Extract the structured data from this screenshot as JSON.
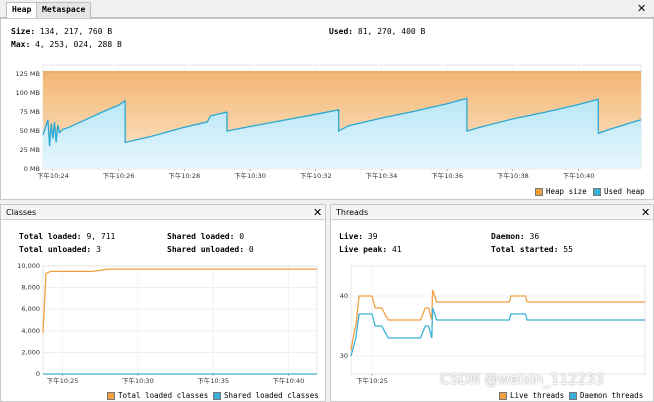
{
  "tabs": [
    {
      "label": "Heap",
      "active": true
    },
    {
      "label": "Metaspace",
      "active": false
    }
  ],
  "heap": {
    "size_label": "Size:",
    "size_value": "134, 217, 760 B",
    "used_label": "Used:",
    "used_value": "81, 270, 400 B",
    "max_label": "Max:",
    "max_value": "4, 253, 024, 288 B",
    "legend": [
      {
        "label": "Heap size",
        "color": "#f0a040"
      },
      {
        "label": "Used heap",
        "color": "#3ab0d8"
      }
    ]
  },
  "classes": {
    "title": "Classes",
    "total_loaded_label": "Total loaded:",
    "total_loaded_value": "9, 711",
    "shared_loaded_label": "Shared loaded:",
    "shared_loaded_value": "0",
    "total_unloaded_label": "Total unloaded:",
    "total_unloaded_value": "3",
    "shared_unloaded_label": "Shared unloaded:",
    "shared_unloaded_value": "0",
    "legend": [
      {
        "label": "Total loaded classes",
        "color": "#f0a040"
      },
      {
        "label": "Shared loaded classes",
        "color": "#3ab0d8"
      }
    ]
  },
  "threads": {
    "title": "Threads",
    "live_label": "Live:",
    "live_value": "39",
    "daemon_label": "Daemon:",
    "daemon_value": "36",
    "live_peak_label": "Live peak:",
    "live_peak_value": "41",
    "total_started_label": "Total started:",
    "total_started_value": "55",
    "legend": [
      {
        "label": "Live threads",
        "color": "#f0a040"
      },
      {
        "label": "Daemon threads",
        "color": "#3ab0d8"
      }
    ]
  },
  "watermark": "CSDN @weixin_112233",
  "chart_data": [
    {
      "type": "area",
      "name": "heap",
      "yticks": [
        "0 MB",
        "25 MB",
        "50 MB",
        "75 MB",
        "100 MB",
        "125 MB"
      ],
      "ylim": [
        0,
        137
      ],
      "xticks": [
        "下午10:24",
        "下午10:26",
        "下午10:28",
        "下午10:30",
        "下午10:32",
        "下午10:34",
        "下午10:36",
        "下午10:38",
        "下午10:40"
      ],
      "xlim": [
        23.7,
        41.9
      ],
      "series": [
        {
          "name": "Heap size",
          "values_x": [
            23.7,
            41.9
          ],
          "values_y": [
            128,
            128
          ]
        },
        {
          "name": "Used heap",
          "values_x": [
            23.7,
            23.85,
            23.9,
            23.95,
            24.0,
            24.05,
            24.1,
            24.15,
            24.2,
            24.3,
            24.5,
            25.0,
            25.5,
            26.0,
            26.2,
            26.201,
            27.0,
            28.0,
            28.7,
            28.8,
            29.3,
            29.301,
            30.0,
            31.0,
            32.0,
            32.7,
            32.701,
            33.0,
            34.0,
            35.0,
            36.0,
            36.6,
            36.601,
            37.0,
            38.0,
            39.0,
            40.0,
            40.6,
            40.601,
            41.0,
            41.9
          ],
          "values_y": [
            45,
            65,
            30,
            60,
            40,
            62,
            35,
            58,
            48,
            52,
            55,
            65,
            75,
            84,
            90,
            35,
            43,
            55,
            62,
            70,
            75,
            50,
            56,
            64,
            72,
            78,
            50,
            57,
            67,
            76,
            86,
            93,
            50,
            55,
            66,
            75,
            85,
            92,
            47,
            53,
            65
          ]
        }
      ]
    },
    {
      "type": "line",
      "name": "classes",
      "yticks": [
        "0",
        "2,000",
        "4,000",
        "6,000",
        "8,000",
        "10,000"
      ],
      "ylim": [
        0,
        10000
      ],
      "xticks": [
        "下午10:25",
        "下午10:30",
        "下午10:35",
        "下午10:40"
      ],
      "xlim": [
        23.7,
        41.9
      ],
      "series": [
        {
          "name": "Total loaded classes",
          "values_x": [
            23.7,
            23.9,
            24.2,
            27.0,
            28.0,
            41.9
          ],
          "values_y": [
            3800,
            9300,
            9500,
            9500,
            9711,
            9711
          ]
        },
        {
          "name": "Shared loaded classes",
          "values_x": [
            23.7,
            41.9
          ],
          "values_y": [
            0,
            0
          ]
        }
      ]
    },
    {
      "type": "line",
      "name": "threads",
      "yticks": [
        "30",
        "40"
      ],
      "ylim": [
        27,
        45
      ],
      "xticks": [
        "下午10:25"
      ],
      "xlim": [
        23.7,
        41.9
      ],
      "series": [
        {
          "name": "Live threads",
          "values_x": [
            23.7,
            23.9,
            24.0,
            24.2,
            25.0,
            25.2,
            25.6,
            26.0,
            28.0,
            28.3,
            28.5,
            28.7,
            28.75,
            29.0,
            33.5,
            33.6,
            34.5,
            34.6,
            41.9
          ],
          "values_y": [
            31,
            34,
            35,
            40,
            40,
            38,
            38,
            36,
            36,
            38,
            38,
            36,
            41,
            39,
            39,
            40,
            40,
            39,
            39
          ]
        },
        {
          "name": "Daemon threads",
          "values_x": [
            23.7,
            23.9,
            24.0,
            24.2,
            25.0,
            25.2,
            25.6,
            26.0,
            28.0,
            28.3,
            28.5,
            28.7,
            28.75,
            29.0,
            33.5,
            33.6,
            34.5,
            34.6,
            41.9
          ],
          "values_y": [
            30,
            32,
            33,
            37,
            37,
            35,
            35,
            33,
            33,
            35,
            35,
            33,
            38,
            36,
            36,
            37,
            37,
            36,
            36
          ]
        }
      ]
    }
  ]
}
